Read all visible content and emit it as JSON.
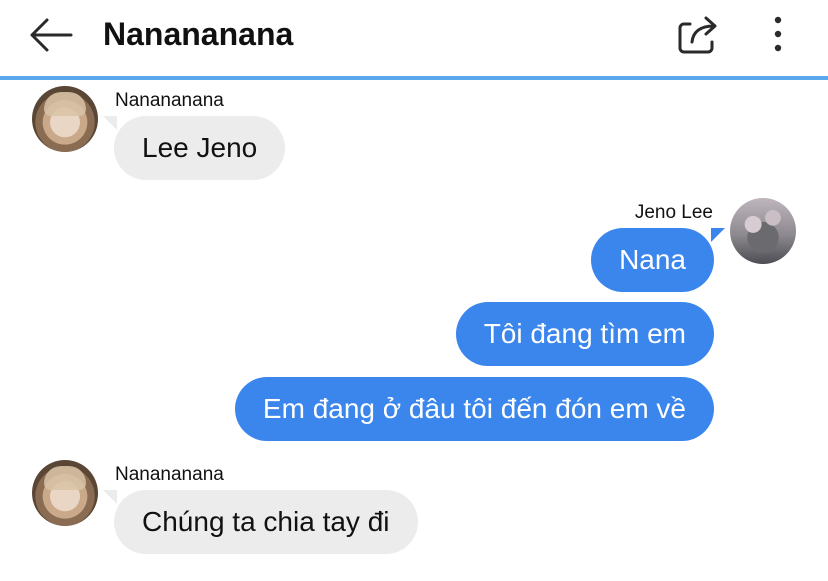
{
  "header": {
    "title": "Nanananana",
    "back_icon": "arrow-left-icon",
    "share_icon": "share-icon",
    "more_icon": "more-vertical-icon",
    "accent_color": "#5aa7ec"
  },
  "messages": [
    {
      "sender": "Nanananana",
      "text": "Lee Jeno",
      "direction": "incoming"
    },
    {
      "sender": "Jeno Lee",
      "text": "Nana",
      "direction": "outgoing"
    },
    {
      "sender": "",
      "text": "Tôi đang tìm em",
      "direction": "outgoing"
    },
    {
      "sender": "",
      "text": "Em đang ở đâu tôi đến đón em về",
      "direction": "outgoing"
    },
    {
      "sender": "Nanananana",
      "text": "Chúng ta chia tay đi",
      "direction": "incoming"
    }
  ],
  "colors": {
    "incoming_bubble": "#ececec",
    "outgoing_bubble": "#3a86ec"
  }
}
